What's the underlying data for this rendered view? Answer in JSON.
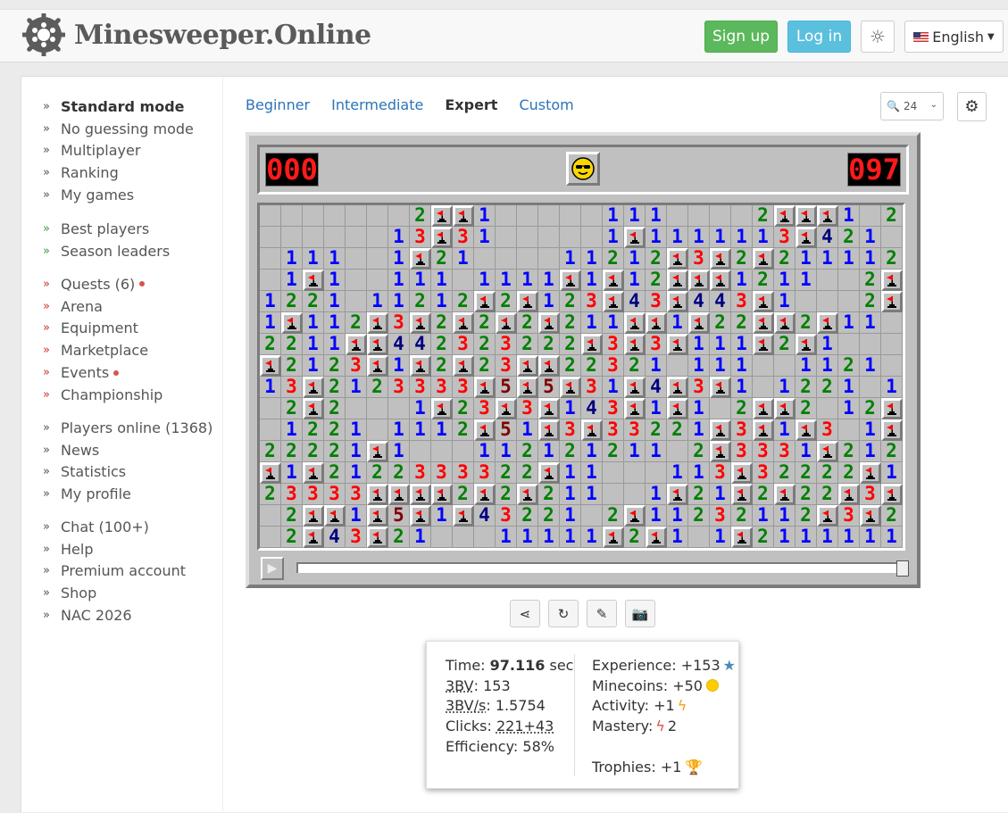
{
  "header": {
    "logo_text": "Minesweeper.Online",
    "signup": "Sign up",
    "login": "Log in",
    "language": "English"
  },
  "nav": {
    "group1": [
      "Standard mode",
      "No guessing mode",
      "Multiplayer",
      "Ranking",
      "My games"
    ],
    "group2": [
      "Best players",
      "Season leaders"
    ],
    "group3": [
      "Quests (6)",
      "Arena",
      "Equipment",
      "Marketplace",
      "Events",
      "Championship"
    ],
    "group4": [
      "Players online (1368)",
      "News",
      "Statistics",
      "My profile"
    ],
    "group5": [
      "Chat (100+)",
      "Help",
      "Premium account",
      "Shop",
      "NAC 2026"
    ]
  },
  "levels": {
    "beginner": "Beginner",
    "intermediate": "Intermediate",
    "expert": "Expert",
    "custom": "Custom"
  },
  "zoom": "24",
  "game": {
    "mines_left": "000",
    "timer": "097",
    "board": [
      "_______2FF1_____111____2FFF1_2F",
      "______13F31_____1F1111113F421_3F",
      "_111__1F21____11212F3F2F2111123F",
      "_1F1__111_1111F1F12FFF1211__2F31F2",
      "1221_11212F2F123F43F443F1___2F322",
      "1F112F3F2F2F2F211FF1F22FF2F11__1F222F",
      "2211FF442323222F3F3F111F2F1___1F21",
      "F2123F1F2F23FF22321_111__1121",
      "13F2123333F5F5F31F4F3F1_1221_123F",
      "_2F2___1F23F3F143F1F1_2FF2_12F1F2",
      "_1221_1112F51F3F33221F3F1F3_1F443",
      "22221F1___112121211_2F3331F2121F2F",
      "F1F2122333322F11___113F32222F12133",
      "23333FFFF2F2F211__1F21F2F22F3F22F1",
      "_2FF1F5F1F43221_2F11232112F3F222F211",
      "_2F43F21___11111F2F1_1F2111111_"
    ]
  },
  "result": {
    "time_label": "Time:",
    "time_value": "97.116",
    "time_unit": "sec",
    "bv_label": "3BV",
    "bv_value": ": 153",
    "bvs_label": "3BV/s",
    "bvs_value": ": 1.5754",
    "clicks_label": "Clicks:",
    "clicks_value": "221",
    "clicks_extra": "+43",
    "efficiency": "Efficiency: 58%",
    "experience": "Experience: +153",
    "minecoins": "Minecoins: +50",
    "activity": "Activity: +1",
    "mastery_label": "Mastery:",
    "mastery_value": "2",
    "trophies": "Trophies: +1"
  }
}
